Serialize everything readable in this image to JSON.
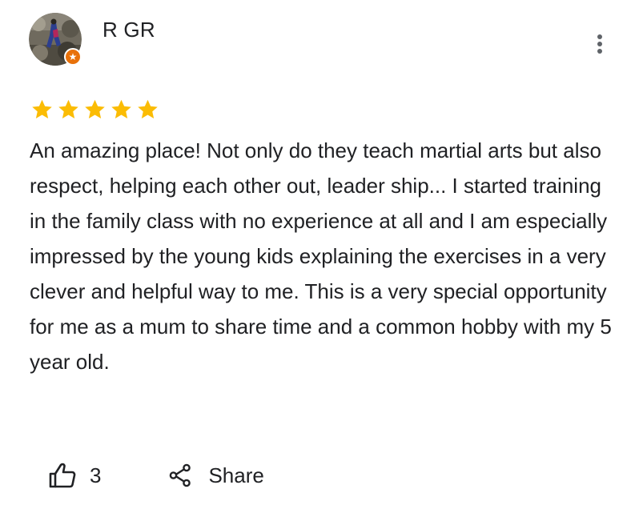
{
  "review": {
    "author": {
      "name": "R GR",
      "local_guide": true,
      "badge_color": "#e8710a"
    },
    "rating": {
      "stars": 5,
      "max": 5,
      "star_color": "#fbbc04"
    },
    "text": "An amazing place! Not only do they teach martial arts but also respect, helping each other out, leader ship... I started training in the family class with no experience at all and I am especially impressed by the young kids explaining the exercises in a very clever and helpful way to me. This is a very special opportunity for me as a mum to share time and a common hobby with my 5 year old.",
    "actions": {
      "like_icon": "thumb-up-icon",
      "like_count": "3",
      "share_icon": "share-icon",
      "share_label": "Share"
    },
    "menu_icon": "more-vert-icon"
  }
}
